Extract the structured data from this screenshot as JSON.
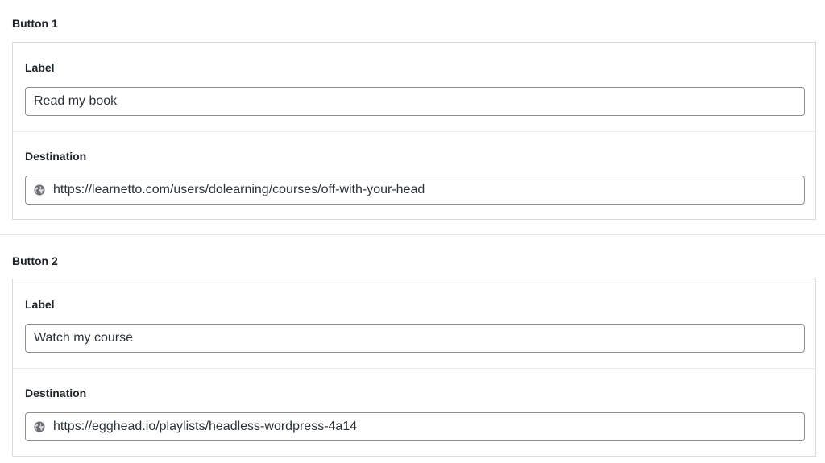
{
  "buttons": [
    {
      "title": "Button 1",
      "label_field": {
        "label": "Label",
        "value": "Read my book"
      },
      "destination_field": {
        "label": "Destination",
        "value": "https://learnetto.com/users/dolearning/courses/off-with-your-head",
        "icon": "globe-icon"
      }
    },
    {
      "title": "Button 2",
      "label_field": {
        "label": "Label",
        "value": "Watch my course"
      },
      "destination_field": {
        "label": "Destination",
        "value": "https://egghead.io/playlists/headless-wordpress-4a14",
        "icon": "globe-icon"
      }
    }
  ],
  "colors": {
    "border": "#dcdcde",
    "input_border": "#8c8f94",
    "text": "#1d2327"
  }
}
